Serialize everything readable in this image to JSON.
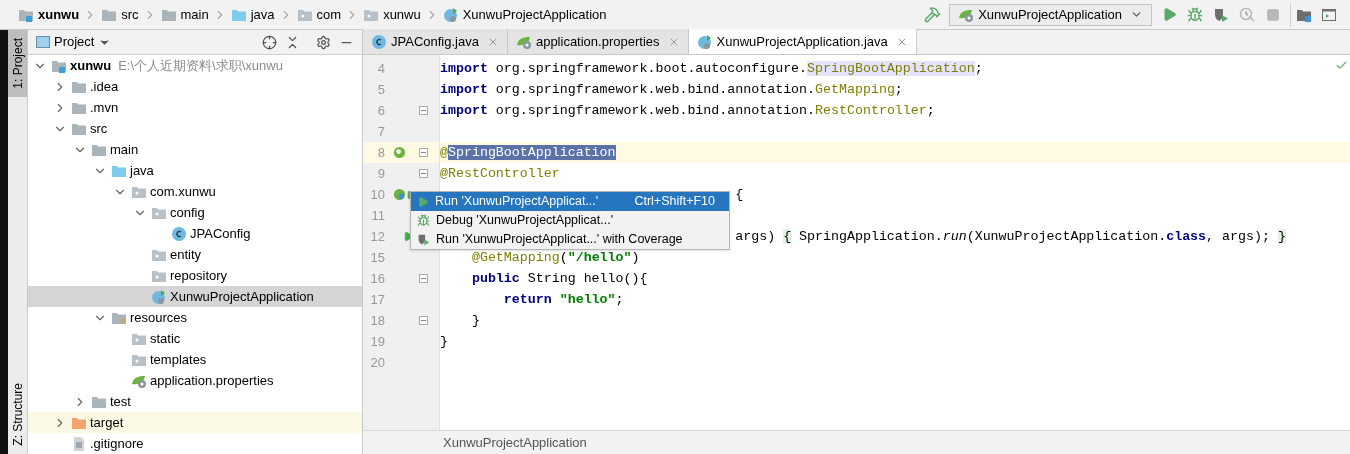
{
  "breadcrumbs": [
    {
      "label": "xunwu",
      "kind": "module"
    },
    {
      "label": "src",
      "kind": "folder"
    },
    {
      "label": "main",
      "kind": "folder"
    },
    {
      "label": "java",
      "kind": "source"
    },
    {
      "label": "com",
      "kind": "package"
    },
    {
      "label": "xunwu",
      "kind": "package"
    },
    {
      "label": "XunwuProjectApplication",
      "kind": "spring_class"
    }
  ],
  "toolbar": [
    {
      "kind": "build",
      "disabled": false
    },
    {
      "kind": "run_config",
      "label": "XunwuProjectApplication"
    },
    {
      "kind": "run",
      "disabled": false
    },
    {
      "kind": "debug",
      "disabled": false
    },
    {
      "kind": "coverage",
      "disabled": false
    },
    {
      "kind": "profile",
      "disabled": true
    },
    {
      "kind": "stop",
      "disabled": true
    },
    {
      "kind": "structure",
      "disabled": false
    },
    {
      "kind": "terminal",
      "disabled": false
    }
  ],
  "tool_strip": [
    {
      "label": "1: Project",
      "selected": true
    },
    {
      "label": "Z: Structure",
      "selected": false
    }
  ],
  "project": {
    "title": "Project",
    "tree": [
      {
        "label": "xunwu",
        "path": "E:\\个人近期资料\\求职\\xunwu",
        "kind": "module",
        "expanded": true,
        "selected": false,
        "children": [
          {
            "label": ".idea",
            "kind": "folder",
            "expanded": false,
            "selected": false
          },
          {
            "label": ".mvn",
            "kind": "folder",
            "expanded": false,
            "selected": false
          },
          {
            "label": "src",
            "kind": "folder",
            "expanded": true,
            "selected": false,
            "children": [
              {
                "label": "main",
                "kind": "folder",
                "expanded": true,
                "selected": false,
                "children": [
                  {
                    "label": "java",
                    "kind": "source",
                    "expanded": true,
                    "selected": false,
                    "children": [
                      {
                        "label": "com.xunwu",
                        "kind": "package",
                        "expanded": true,
                        "selected": false,
                        "children": [
                          {
                            "label": "config",
                            "kind": "package",
                            "expanded": true,
                            "selected": false,
                            "children": [
                              {
                                "label": "JPAConfig",
                                "kind": "class",
                                "selected": false
                              }
                            ]
                          },
                          {
                            "label": "entity",
                            "kind": "package",
                            "selected": false
                          },
                          {
                            "label": "repository",
                            "kind": "package",
                            "selected": false
                          },
                          {
                            "label": "XunwuProjectApplication",
                            "kind": "spring_class",
                            "selected": true
                          }
                        ]
                      }
                    ]
                  },
                  {
                    "label": "resources",
                    "kind": "resources",
                    "expanded": true,
                    "selected": false,
                    "children": [
                      {
                        "label": "static",
                        "kind": "package",
                        "selected": false
                      },
                      {
                        "label": "templates",
                        "kind": "package",
                        "selected": false
                      },
                      {
                        "label": "application.properties",
                        "kind": "spring_config",
                        "selected": false
                      }
                    ]
                  }
                ]
              },
              {
                "label": "test",
                "kind": "folder",
                "expanded": false,
                "selected": false
              }
            ]
          },
          {
            "label": "target",
            "kind": "excluded",
            "expanded": false,
            "selected": false
          },
          {
            "label": ".gitignore",
            "kind": "file",
            "selected": false
          }
        ]
      }
    ]
  },
  "tabs": [
    {
      "label": "JPAConfig.java",
      "kind": "class",
      "selected": false
    },
    {
      "label": "application.properties",
      "kind": "spring_config",
      "selected": false
    },
    {
      "label": "XunwuProjectApplication.java",
      "kind": "spring_class",
      "selected": true
    }
  ],
  "editor": {
    "lines": [
      {
        "number": "4",
        "current": false,
        "fold": false,
        "covered": false,
        "tokens": [
          {
            "text": "import",
            "kind": "keyword"
          },
          {
            "text": " org.springframework.boot.autoconfigure.",
            "kind": "plain"
          },
          {
            "text": "SpringBootApplication",
            "kind": "type_usage"
          },
          {
            "text": ";",
            "kind": "plain"
          }
        ]
      },
      {
        "number": "5",
        "current": false,
        "fold": false,
        "covered": false,
        "tokens": [
          {
            "text": "import",
            "kind": "keyword"
          },
          {
            "text": " org.springframework.web.bind.annotation.",
            "kind": "plain"
          },
          {
            "text": "GetMapping",
            "kind": "type"
          },
          {
            "text": ";",
            "kind": "plain"
          }
        ]
      },
      {
        "number": "6",
        "current": false,
        "fold": true,
        "covered": false,
        "tokens": [
          {
            "text": "import",
            "kind": "keyword"
          },
          {
            "text": " org.springframework.web.bind.annotation.",
            "kind": "plain"
          },
          {
            "text": "RestController",
            "kind": "type"
          },
          {
            "text": ";",
            "kind": "plain"
          }
        ]
      },
      {
        "number": "7",
        "current": false,
        "fold": false,
        "covered": false
      },
      {
        "number": "8",
        "current": true,
        "fold": true,
        "covered": false,
        "gutter": {
          "kind": "spring"
        },
        "tokens": [
          {
            "text": "@",
            "kind": "type"
          },
          {
            "text": "SpringBootApplication",
            "kind": "selection"
          }
        ]
      },
      {
        "number": "9",
        "current": false,
        "fold": true,
        "covered": false,
        "tokens": [
          {
            "text": "@RestController",
            "kind": "type"
          }
        ]
      },
      {
        "number": "10",
        "current": false,
        "covered": true,
        "gutter": {
          "kind": "spring_run"
        },
        "tokens": [
          {
            "text": "{",
            "kind": "plain"
          }
        ]
      },
      {
        "number": "11",
        "current": false,
        "covered": false
      },
      {
        "number": "12",
        "current": false,
        "covered": true,
        "gutter": {
          "kind": "run"
        },
        "tokens": [
          {
            "text": "args) ",
            "kind": "plain"
          },
          {
            "text": "{",
            "kind": "brace_match"
          },
          {
            "text": " SpringApplication.",
            "kind": "plain"
          },
          {
            "text": "run",
            "kind": "italic"
          },
          {
            "text": "(XunwuProjectApplication.",
            "kind": "plain"
          },
          {
            "text": "class",
            "kind": "keyword"
          },
          {
            "text": ", args); ",
            "kind": "plain"
          },
          {
            "text": "}",
            "kind": "brace_match"
          }
        ]
      },
      {
        "number": "15",
        "current": false,
        "fold": false,
        "covered": false,
        "tokens": [
          {
            "text": "    @GetMapping",
            "kind": "type"
          },
          {
            "text": "(",
            "kind": "plain"
          },
          {
            "text": "\"/hello\"",
            "kind": "string"
          },
          {
            "text": ")",
            "kind": "plain"
          }
        ]
      },
      {
        "number": "16",
        "current": false,
        "fold": true,
        "covered": false,
        "tokens": [
          {
            "text": "    public",
            "kind": "keyword"
          },
          {
            "text": " String hello(){",
            "kind": "plain"
          }
        ]
      },
      {
        "number": "17",
        "current": false,
        "fold": false,
        "covered": false,
        "tokens": [
          {
            "text": "        return",
            "kind": "keyword"
          },
          {
            "text": " \"hello\"",
            "kind": "string"
          },
          {
            "text": ";",
            "kind": "plain"
          }
        ]
      },
      {
        "number": "18",
        "current": false,
        "fold": true,
        "covered": false,
        "tokens": [
          {
            "text": "    }",
            "kind": "plain"
          }
        ]
      },
      {
        "number": "19",
        "current": false,
        "fold": false,
        "covered": false,
        "tokens": [
          {
            "text": "}",
            "kind": "plain"
          }
        ]
      },
      {
        "number": "20",
        "current": false,
        "fold": false,
        "covered": false
      }
    ],
    "popup": [
      {
        "label": "Run 'XunwuProjectApplicat...'",
        "shortcut": "Ctrl+Shift+F10",
        "kind": "run",
        "selected": true
      },
      {
        "label": "Debug 'XunwuProjectApplicat...'",
        "kind": "debug",
        "selected": false
      },
      {
        "label": "Run 'XunwuProjectApplicat...' with Coverage",
        "kind": "coverage",
        "selected": false
      }
    ],
    "breadcrumb": "XunwuProjectApplication"
  }
}
